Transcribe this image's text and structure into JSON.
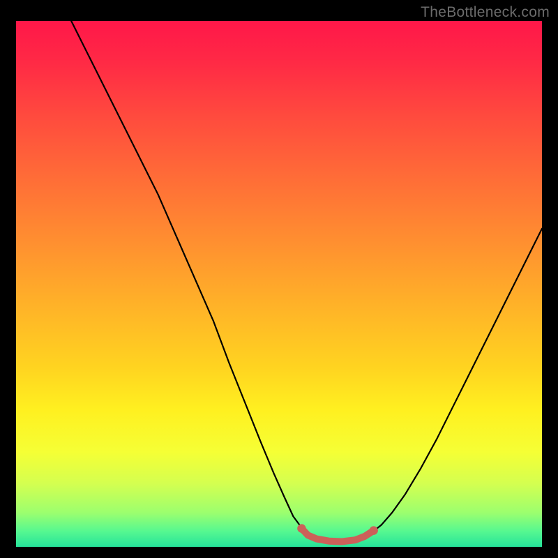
{
  "watermark": {
    "text": "TheBottleneck.com"
  },
  "chart_data": {
    "type": "line",
    "title": "",
    "xlabel": "",
    "ylabel": "",
    "xlim": [
      0,
      1
    ],
    "ylim": [
      0,
      1
    ],
    "background_gradient": [
      {
        "stop": 0.0,
        "color": "#ff1749"
      },
      {
        "stop": 0.08,
        "color": "#ff2a45"
      },
      {
        "stop": 0.18,
        "color": "#ff4a3e"
      },
      {
        "stop": 0.3,
        "color": "#ff6d37"
      },
      {
        "stop": 0.42,
        "color": "#ff8f30"
      },
      {
        "stop": 0.54,
        "color": "#ffb228"
      },
      {
        "stop": 0.66,
        "color": "#ffd420"
      },
      {
        "stop": 0.74,
        "color": "#fff020"
      },
      {
        "stop": 0.82,
        "color": "#f5ff35"
      },
      {
        "stop": 0.88,
        "color": "#d4ff50"
      },
      {
        "stop": 0.935,
        "color": "#9cff6e"
      },
      {
        "stop": 0.97,
        "color": "#57f890"
      },
      {
        "stop": 1.0,
        "color": "#25e39a"
      }
    ],
    "series": [
      {
        "name": "bottleneck-curve",
        "color": "#000000",
        "width": 2.2,
        "points": [
          {
            "x": 0.105,
            "y": 1.0
          },
          {
            "x": 0.12,
            "y": 0.97
          },
          {
            "x": 0.14,
            "y": 0.93
          },
          {
            "x": 0.17,
            "y": 0.87
          },
          {
            "x": 0.2,
            "y": 0.81
          },
          {
            "x": 0.235,
            "y": 0.74
          },
          {
            "x": 0.27,
            "y": 0.67
          },
          {
            "x": 0.305,
            "y": 0.59
          },
          {
            "x": 0.34,
            "y": 0.51
          },
          {
            "x": 0.375,
            "y": 0.43
          },
          {
            "x": 0.405,
            "y": 0.35
          },
          {
            "x": 0.435,
            "y": 0.275
          },
          {
            "x": 0.465,
            "y": 0.2
          },
          {
            "x": 0.49,
            "y": 0.14
          },
          {
            "x": 0.51,
            "y": 0.095
          },
          {
            "x": 0.527,
            "y": 0.058
          },
          {
            "x": 0.544,
            "y": 0.035
          },
          {
            "x": 0.558,
            "y": 0.023
          },
          {
            "x": 0.578,
            "y": 0.015
          },
          {
            "x": 0.6,
            "y": 0.01
          },
          {
            "x": 0.628,
            "y": 0.01
          },
          {
            "x": 0.656,
            "y": 0.017
          },
          {
            "x": 0.675,
            "y": 0.026
          },
          {
            "x": 0.695,
            "y": 0.042
          },
          {
            "x": 0.715,
            "y": 0.065
          },
          {
            "x": 0.74,
            "y": 0.1
          },
          {
            "x": 0.77,
            "y": 0.15
          },
          {
            "x": 0.8,
            "y": 0.205
          },
          {
            "x": 0.83,
            "y": 0.265
          },
          {
            "x": 0.86,
            "y": 0.325
          },
          {
            "x": 0.89,
            "y": 0.385
          },
          {
            "x": 0.92,
            "y": 0.445
          },
          {
            "x": 0.95,
            "y": 0.505
          },
          {
            "x": 0.98,
            "y": 0.565
          },
          {
            "x": 1.0,
            "y": 0.605
          }
        ]
      },
      {
        "name": "optimal-range-marker",
        "color": "#cc6059",
        "width": 10,
        "points": [
          {
            "x": 0.543,
            "y": 0.035
          },
          {
            "x": 0.555,
            "y": 0.022
          },
          {
            "x": 0.572,
            "y": 0.015
          },
          {
            "x": 0.595,
            "y": 0.011
          },
          {
            "x": 0.62,
            "y": 0.01
          },
          {
            "x": 0.645,
            "y": 0.013
          },
          {
            "x": 0.663,
            "y": 0.02
          },
          {
            "x": 0.68,
            "y": 0.031
          }
        ],
        "endpoint_dots": true
      }
    ]
  }
}
